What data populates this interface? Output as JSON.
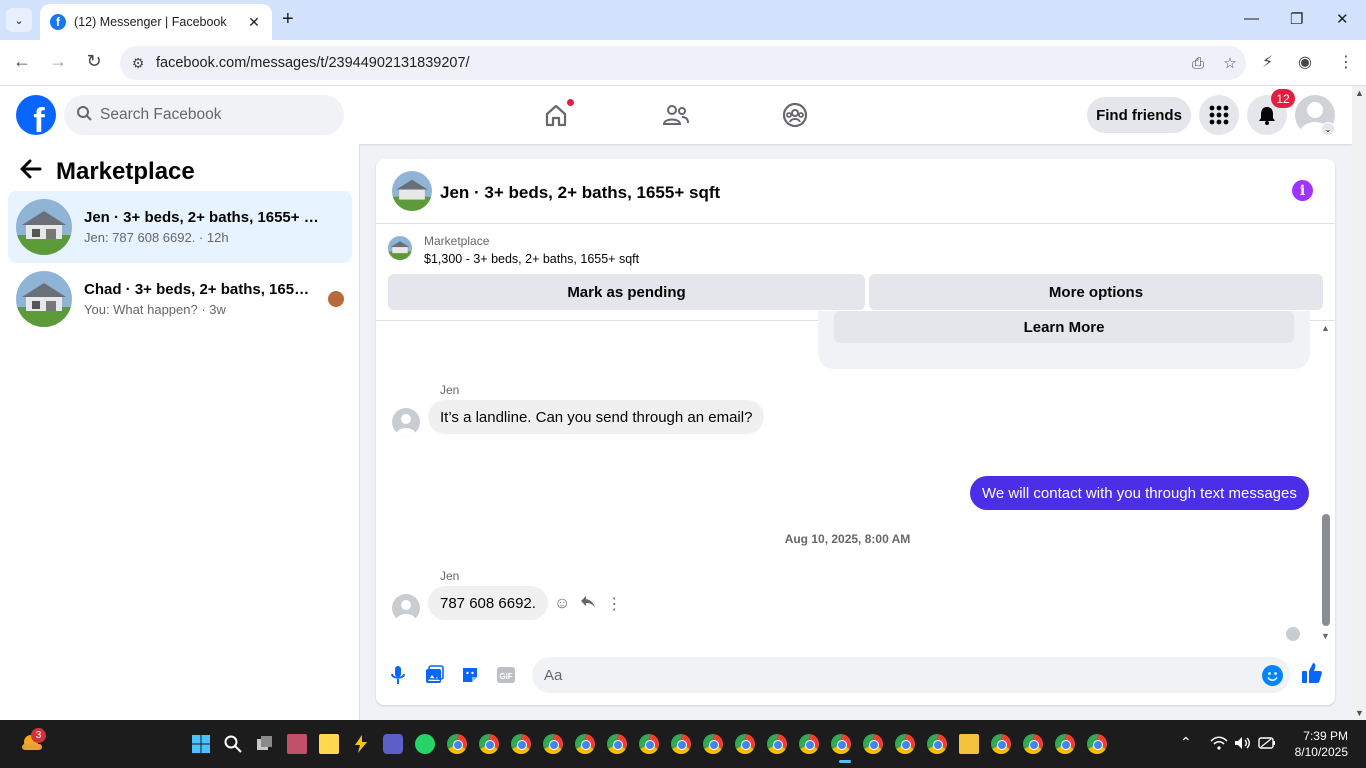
{
  "browser": {
    "tab_title": "(12) Messenger | Facebook",
    "url": "facebook.com/messages/t/23944902131839207/"
  },
  "fb": {
    "search_placeholder": "Search Facebook",
    "find_friends": "Find friends",
    "notification_count": "12"
  },
  "sidebar": {
    "title": "Marketplace",
    "threads": [
      {
        "name": "Jen · 3+ beds, 2+ baths, 1655+ sqft",
        "preview": "Jen: 787 608 6692. · 12h"
      },
      {
        "name": "Chad · 3+ beds, 2+ baths, 1655+...",
        "preview": "You: What happen? · 3w"
      }
    ]
  },
  "chat": {
    "title": "Jen · 3+ beds, 2+ baths, 1655+ sqft",
    "listing_label": "Marketplace",
    "listing_detail": "$1,300 - 3+ beds, 2+ baths, 1655+ sqft",
    "mark_pending": "Mark as pending",
    "more_options": "More options",
    "learn_more": "Learn More",
    "messages": [
      {
        "sender": "Jen",
        "text": "It’s a landline. Can you send through an email?"
      },
      {
        "text": "We will contact with you through text messages"
      },
      {
        "sender": "Jen",
        "text": "787 608 6692."
      }
    ],
    "timestamp": "Aug 10, 2025, 8:00 AM",
    "composer_placeholder": "Aa"
  },
  "taskbar": {
    "weather_badge": "3",
    "time": "7:39 PM",
    "date": "8/10/2025"
  },
  "colors": {
    "fb_blue": "#0866ff",
    "outgoing_bubble": "#4b2ee8",
    "active_thread": "#e7f3ff"
  }
}
